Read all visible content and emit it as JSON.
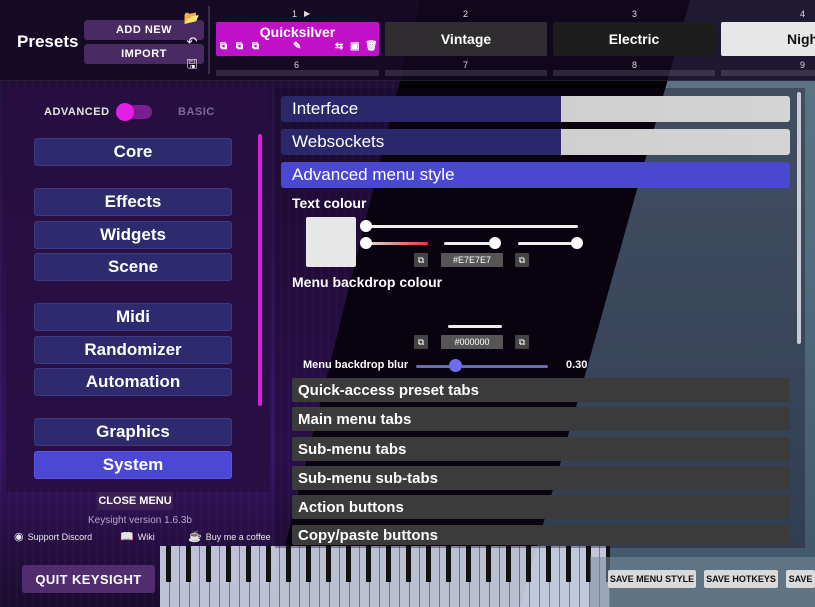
{
  "presets": {
    "title": "Presets",
    "add_new": "ADD NEW",
    "import": "IMPORT",
    "slots": [
      {
        "num": "1",
        "name": "Quicksilver"
      },
      {
        "num": "2",
        "name": "Vintage"
      },
      {
        "num": "3",
        "name": "Electric"
      },
      {
        "num": "4",
        "name": "Nigh"
      }
    ],
    "row2_nums": [
      "6",
      "7",
      "8",
      "9"
    ]
  },
  "mode_toggle": {
    "advanced": "ADVANCED",
    "basic": "BASIC"
  },
  "menu": {
    "items": [
      "Core",
      "Effects",
      "Widgets",
      "Scene",
      "Midi",
      "Randomizer",
      "Automation",
      "Graphics",
      "System"
    ],
    "active": "System"
  },
  "footer": {
    "close_menu": "CLOSE MENU",
    "version": "Keysight version 1.6.3b",
    "support_discord": "Support Discord",
    "wiki": "Wiki",
    "buy_coffee": "Buy me a coffee",
    "quit": "QUIT KEYSIGHT"
  },
  "settings": {
    "sections": [
      "Interface",
      "Websockets",
      "Advanced menu style"
    ],
    "text_colour": {
      "label": "Text colour",
      "hex": "#E7E7E7",
      "swatch": "#e7e7e7"
    },
    "backdrop_colour": {
      "label": "Menu backdrop colour",
      "hex": "#000000"
    },
    "blur": {
      "label": "Menu backdrop blur",
      "value": "0.30"
    },
    "subsections": [
      "Quick-access preset tabs",
      "Main menu tabs",
      "Sub-menu tabs",
      "Sub-menu sub-tabs",
      "Action buttons",
      "Copy/paste buttons"
    ]
  },
  "actions": {
    "save_menu_style": "SAVE MENU STYLE",
    "save_hotkeys": "SAVE HOTKEYS",
    "save": "SAVE"
  },
  "colors": {
    "accent": "#c010c8",
    "menu_button": "#2d2a6d",
    "menu_active": "#4c48d6"
  }
}
